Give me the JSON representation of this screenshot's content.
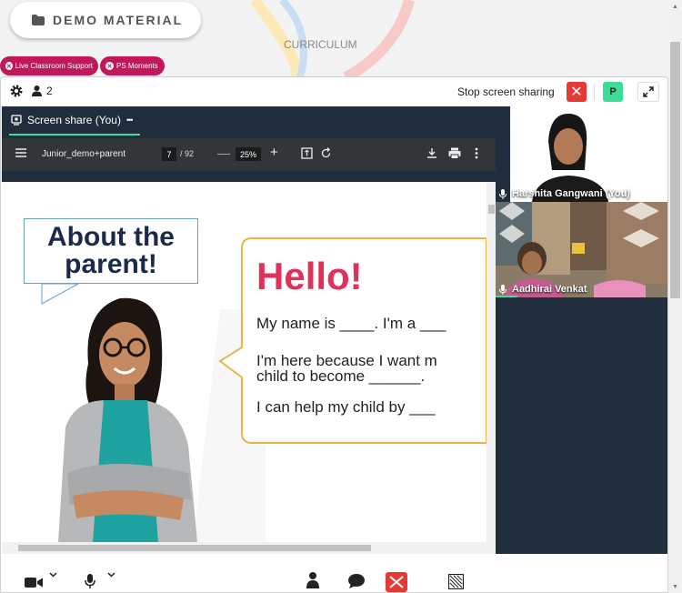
{
  "header": {
    "demo_button_label": "DEMO MATERIAL",
    "curriculum_label": "CURRICULUM"
  },
  "pills": [
    {
      "label": "Live Classroom Support"
    },
    {
      "label": "PS Moments"
    }
  ],
  "topbar": {
    "participant_count": "2",
    "stop_sharing_label": "Stop screen sharing",
    "avatar_initial": "P"
  },
  "share": {
    "tab_label": "Screen share (You)",
    "more_label": "•••",
    "pdf": {
      "title": "Junior_demo+parent",
      "current_page": "7",
      "total_pages": "/ 92",
      "zoom_minus": "—",
      "zoom": "25%",
      "zoom_plus": "+"
    },
    "slide": {
      "heading_line1": "About the",
      "heading_line2": "parent!",
      "hello": "Hello!",
      "line1": "My name is ____. I'm a ___",
      "line2a": "I'm here because I want m",
      "line2b": "child to become ______.",
      "line3": "I can help my child by ___"
    }
  },
  "participants": [
    {
      "name": "Harshita Gangwani (You)"
    },
    {
      "name": "Aadhirai Venkat"
    }
  ],
  "colors": {
    "brand_pink": "#c2185b",
    "accent_green": "#3ddc97",
    "stop_red": "#e53935",
    "panel_dark": "#1f2d3d"
  }
}
